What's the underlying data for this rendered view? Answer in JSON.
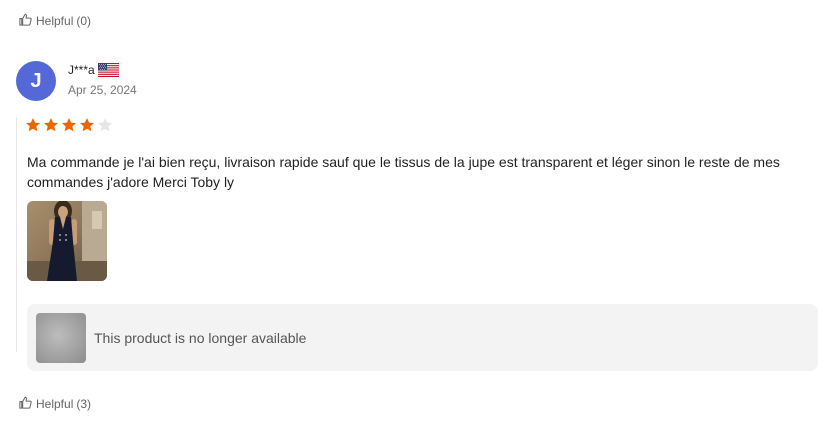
{
  "helpful_top": {
    "label": "Helpful",
    "count": "(0)"
  },
  "review": {
    "avatar_letter": "J",
    "avatar_color": "#5468d8",
    "name": "J***a",
    "flag": "us-flag-icon",
    "date": "Apr 25, 2024",
    "rating": 4,
    "rating_max": 5,
    "star_color": "#f06400",
    "star_empty_color": "#e6e6e6",
    "text": "Ma commande je l'ai bien reçu, livraison rapide sauf que le tissus de la jupe est transparent et léger sinon le reste de mes commandes j'adore Merci Toby ly",
    "product_status": "This product is no longer available"
  },
  "helpful_bottom": {
    "label": "Helpful",
    "count": "(3)"
  }
}
